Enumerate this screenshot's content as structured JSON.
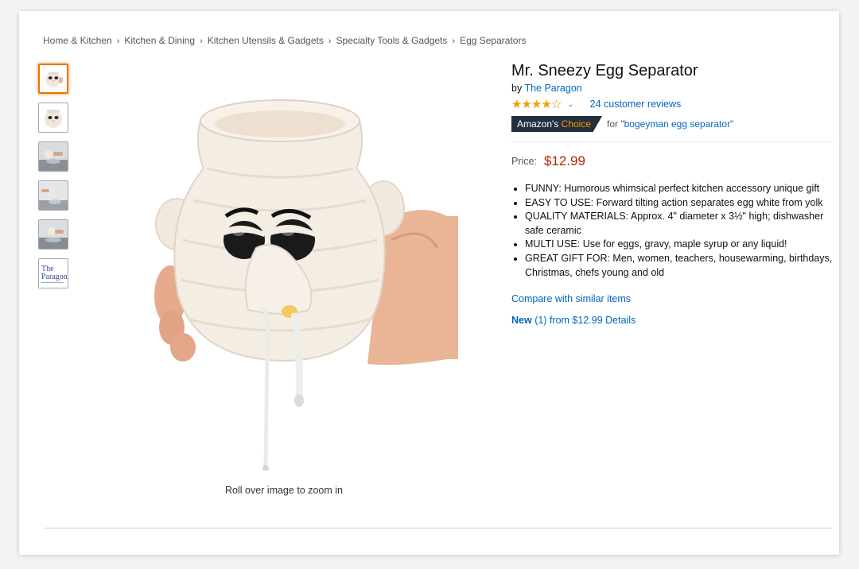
{
  "breadcrumb": [
    "Home & Kitchen",
    "Kitchen & Dining",
    "Kitchen Utensils & Gadgets",
    "Specialty Tools & Gadgets",
    "Egg Separators"
  ],
  "breadcrumb_separator": "›",
  "product": {
    "title": "Mr. Sneezy Egg Separator",
    "by_prefix": "by",
    "brand": "The Paragon",
    "rating": 4,
    "rating_max": 5,
    "reviews_link": "24 customer reviews",
    "choice_badge_prefix": "Amazon's",
    "choice_badge_highlight": "Choice",
    "choice_for_prefix": "for",
    "choice_for_query": "\"bogeyman egg separator\"",
    "price_label": "Price:",
    "price": "$12.99",
    "bullets": [
      "FUNNY: Humorous whimsical perfect kitchen accessory unique gift",
      "EASY TO USE: Forward tilting action separates egg white from yolk",
      "QUALITY MATERIALS: Approx. 4\" diameter x 3½\" high; dishwasher safe ceramic",
      "MULTI USE: Use for eggs, gravy, maple syrup or any liquid!",
      "GREAT GIFT FOR: Men, women, teachers, housewarming, birthdays, Christmas, chefs young and old"
    ],
    "compare_link": "Compare with similar items",
    "offers_new": "New",
    "offers_rest": "(1) from $12.99 Details"
  },
  "gallery": {
    "zoom_hint": "Roll over image to zoom in",
    "thumbnails": [
      "product-front",
      "product-face",
      "in-use-bowl",
      "in-use-pour",
      "in-use-bowl-2",
      "brand-logo"
    ],
    "selected_index": 0,
    "logo_text_line1": "The",
    "logo_text_line2": "Paragon"
  },
  "colors": {
    "link": "#0066c0",
    "price": "#b12704",
    "badge_bg": "#232f3e",
    "badge_accent": "#ff9900",
    "star": "#f0a000"
  }
}
